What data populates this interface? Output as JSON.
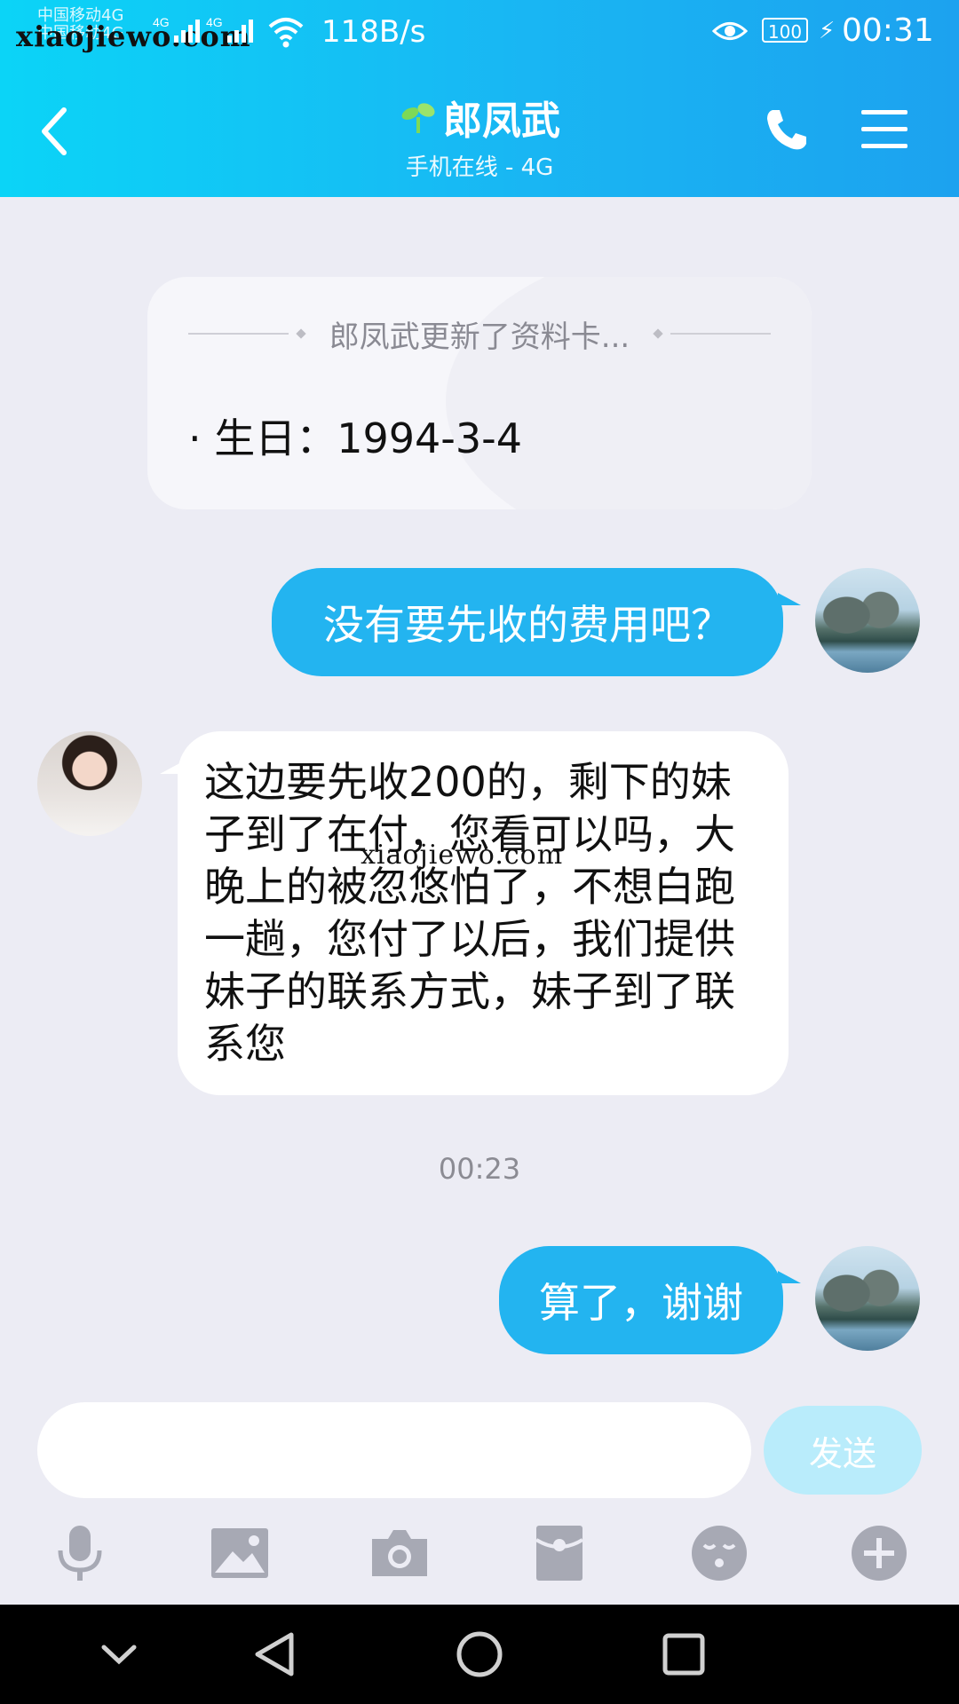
{
  "status_bar": {
    "carrier_1": "中国移动4G",
    "carrier_2": "中国移动4G",
    "net_label_1": "4G",
    "net_label_2": "4G",
    "speed": "118B/s",
    "battery": "100",
    "time": "00:31",
    "watermark": "xiaojiewo.com"
  },
  "header": {
    "contact_name": "郎凤武",
    "contact_status": "手机在线 - 4G"
  },
  "profile_card": {
    "headline": "郎凤武更新了资料卡...",
    "detail": "· 生日：1994-3-4"
  },
  "messages": {
    "m1": "没有要先收的费用吧？",
    "m2": "这边要先收200的，剩下的妹子到了在付，您看可以吗，大晚上的被忽悠怕了，不想白跑一趟，您付了以后，我们提供妹子的联系方式，妹子到了联系您",
    "timestamp": "00:23",
    "m3": "算了，谢谢"
  },
  "watermark_mid": "xiaojiewo.com",
  "composer": {
    "placeholder": "",
    "send_label": "发送"
  },
  "toolbar_icons": [
    "microphone-icon",
    "image-icon",
    "camera-icon",
    "red-packet-icon",
    "emoji-icon",
    "plus-icon"
  ],
  "colors": {
    "header_start": "#0bd4f7",
    "header_end": "#1ca2ef",
    "outgoing_bubble": "#23b4f0",
    "background": "#ececf4",
    "send_disabled": "#b9ecfb"
  }
}
